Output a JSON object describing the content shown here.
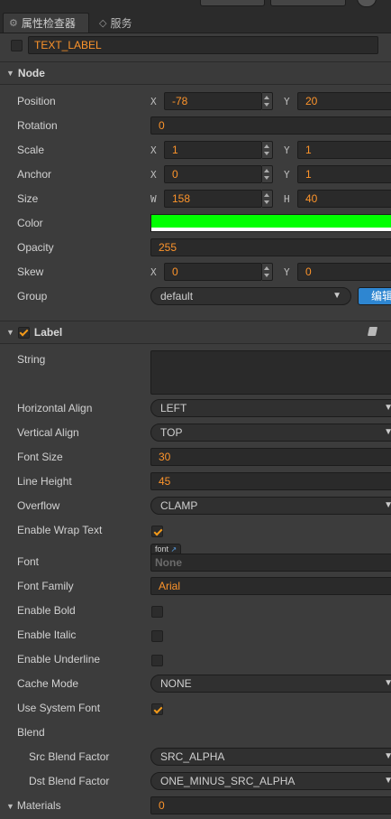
{
  "tabs": [
    {
      "label": "属性检查器",
      "icon": "gear-icon"
    },
    {
      "label": "服务",
      "icon": "link-icon"
    }
  ],
  "node_name": "TEXT_LABEL",
  "node_section": {
    "title": "Node",
    "position": {
      "label": "Position",
      "x": "-78",
      "y": "20"
    },
    "rotation": {
      "label": "Rotation",
      "value": "0"
    },
    "scale": {
      "label": "Scale",
      "x": "1",
      "y": "1"
    },
    "anchor": {
      "label": "Anchor",
      "x": "0",
      "y": "1"
    },
    "size": {
      "label": "Size",
      "w": "158",
      "h": "40"
    },
    "color": {
      "label": "Color",
      "value": "#00ff00"
    },
    "opacity": {
      "label": "Opacity",
      "value": "255"
    },
    "skew": {
      "label": "Skew",
      "x": "0",
      "y": "0"
    },
    "group": {
      "label": "Group",
      "value": "default",
      "edit_button": "编辑"
    },
    "axes": {
      "x": "X",
      "y": "Y",
      "w": "W",
      "h": "H"
    }
  },
  "label_section": {
    "title": "Label",
    "string": {
      "label": "String",
      "value": ""
    },
    "horizontal_align": {
      "label": "Horizontal Align",
      "value": "LEFT"
    },
    "vertical_align": {
      "label": "Vertical Align",
      "value": "TOP"
    },
    "font_size": {
      "label": "Font Size",
      "value": "30"
    },
    "line_height": {
      "label": "Line Height",
      "value": "45"
    },
    "overflow": {
      "label": "Overflow",
      "value": "CLAMP"
    },
    "enable_wrap_text": {
      "label": "Enable Wrap Text",
      "checked": true
    },
    "font": {
      "label": "Font",
      "tag": "font",
      "placeholder": "None"
    },
    "font_family": {
      "label": "Font Family",
      "value": "Arial"
    },
    "enable_bold": {
      "label": "Enable Bold",
      "checked": false
    },
    "enable_italic": {
      "label": "Enable Italic",
      "checked": false
    },
    "enable_underline": {
      "label": "Enable Underline",
      "checked": false
    },
    "cache_mode": {
      "label": "Cache Mode",
      "value": "NONE"
    },
    "use_system_font": {
      "label": "Use System Font",
      "checked": true
    },
    "blend": {
      "label": "Blend"
    },
    "src_blend_factor": {
      "label": "Src Blend Factor",
      "value": "SRC_ALPHA"
    },
    "dst_blend_factor": {
      "label": "Dst Blend Factor",
      "value": "ONE_MINUS_SRC_ALPHA"
    },
    "materials": {
      "label": "Materials",
      "value": "0"
    }
  },
  "colors": {
    "accent": "#fd942b",
    "edit_button": "#2e86d1",
    "color_swatch": "#00ff00"
  }
}
